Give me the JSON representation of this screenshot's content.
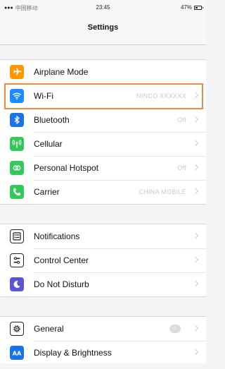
{
  "status_bar": {
    "signal": "●●●",
    "carrier": "中国移动",
    "time": "23:45",
    "battery": "47%"
  },
  "nav": {
    "title": "Settings"
  },
  "groups": [
    {
      "items": [
        {
          "label": "Airplane Mode",
          "value": "",
          "icon": "airplane-icon",
          "color": "#ff9500"
        },
        {
          "label": "Wi-Fi",
          "value": "NINCO XXXXXX",
          "icon": "wifi-icon",
          "color": "#1a8cff"
        },
        {
          "label": "Bluetooth",
          "value": "Off",
          "icon": "bluetooth-icon",
          "color": "#1a73e8"
        },
        {
          "label": "Cellular",
          "value": "",
          "icon": "cellular-antenna-icon",
          "color": "#34c759"
        },
        {
          "label": "Personal Hotspot",
          "value": "Off",
          "icon": "hotspot-icon",
          "color": "#34c759"
        },
        {
          "label": "Carrier",
          "value": "CHINA MOBILE",
          "icon": "phone-icon",
          "color": "#34c759"
        }
      ]
    },
    {
      "items": [
        {
          "label": "Notifications",
          "value": "",
          "icon": "notifications-icon",
          "color": "#ffffff"
        },
        {
          "label": "Control Center",
          "value": "",
          "icon": "control-center-icon",
          "color": "#ffffff"
        },
        {
          "label": "Do Not Disturb",
          "value": "",
          "icon": "moon-icon",
          "color": "#5856d6"
        }
      ]
    },
    {
      "items": [
        {
          "label": "General",
          "value": "",
          "badge": "1",
          "icon": "gear-icon",
          "color": "#ffffff"
        },
        {
          "label": "Display & Brightness",
          "value": "",
          "icon": "display-brightness-icon",
          "color": "#1a73e8"
        }
      ]
    }
  ]
}
